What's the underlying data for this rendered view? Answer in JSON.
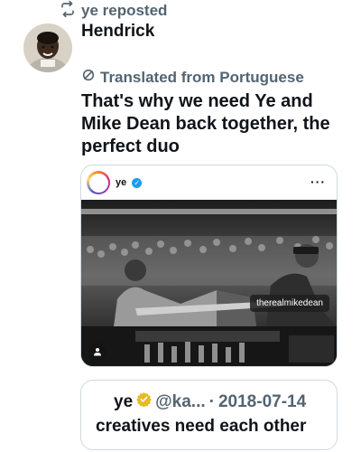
{
  "repost": {
    "label": "ye reposted"
  },
  "author": {
    "name": "Hendrick"
  },
  "translation": {
    "label": "Translated from Portuguese"
  },
  "tweet": {
    "text": "That's why we need Ye and Mike Dean back together, the perfect duo"
  },
  "instagram_post": {
    "username": "ye",
    "tag": "therealmikedean",
    "more_icon": "more-horizontal-icon"
  },
  "quote": {
    "name": "ye",
    "handle": "@ka...",
    "separator": "·",
    "date": "2018-07-14",
    "text": "creatives need each other"
  },
  "colors": {
    "text_primary": "#0f1419",
    "text_secondary": "#536471",
    "verified_gold": "#e8b923",
    "verified_blue": "#1d9bf0",
    "border": "#cfd9de"
  }
}
